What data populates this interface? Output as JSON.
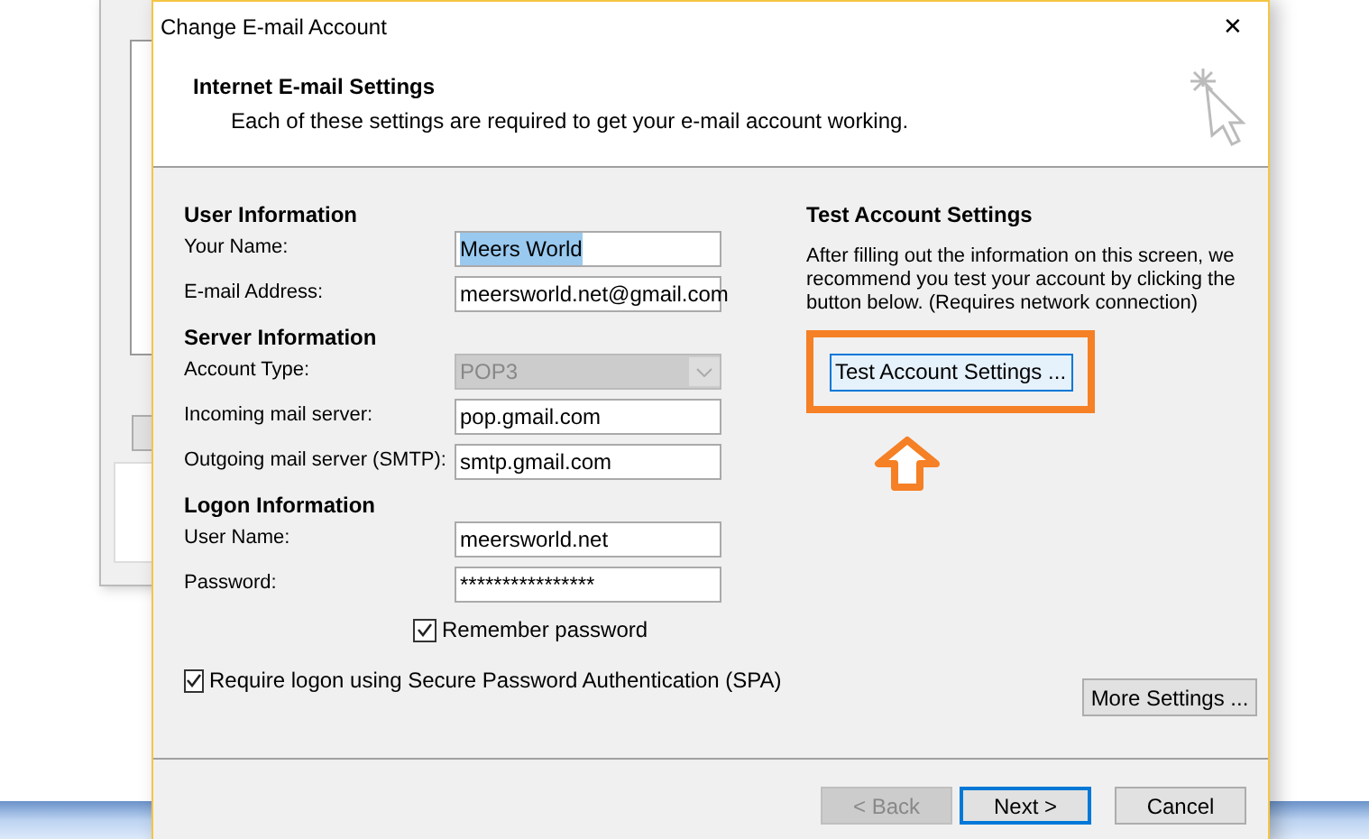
{
  "dialog": {
    "title": "Change E-mail Account",
    "close": "✕",
    "header": {
      "title": "Internet E-mail Settings",
      "subtitle": "Each of these settings are required to get your e-mail account working."
    },
    "sections": [
      {
        "title": "User Information",
        "fields": [
          {
            "label": "Your Name:",
            "value": "Meers World",
            "kind": "text",
            "highlighted": true,
            "disabled": false
          },
          {
            "label": "E-mail Address:",
            "value": "meersworld.net@gmail.com",
            "kind": "text",
            "highlighted": false,
            "disabled": false
          }
        ]
      },
      {
        "title": "Server Information",
        "fields": [
          {
            "label": "Account Type:",
            "value": "POP3",
            "kind": "select",
            "highlighted": false,
            "disabled": true
          },
          {
            "label": "Incoming mail server:",
            "value": "pop.gmail.com",
            "kind": "text",
            "highlighted": false,
            "disabled": false
          },
          {
            "label": "Outgoing mail server (SMTP):",
            "value": "smtp.gmail.com",
            "kind": "text",
            "highlighted": false,
            "disabled": false
          }
        ]
      },
      {
        "title": "Logon Information",
        "fields": [
          {
            "label": "User Name:",
            "value": "meersworld.net",
            "kind": "text",
            "highlighted": false,
            "disabled": false
          },
          {
            "label": "Password:",
            "value": "****************",
            "kind": "text",
            "highlighted": false,
            "disabled": false
          }
        ]
      }
    ],
    "remember_password": {
      "label": "Remember password",
      "checked": true
    },
    "require_spa": {
      "label": "Require logon using Secure Password Authentication (SPA)",
      "checked": true
    },
    "test": {
      "title": "Test Account Settings",
      "text": "After filling out the information on this screen, we recommend you test your account by clicking the button below. (Requires network connection)",
      "button": "Test Account Settings ...",
      "callout": true
    },
    "more_settings": "More Settings ...",
    "buttons": [
      {
        "label": "< Back",
        "disabled": true,
        "default": false
      },
      {
        "label": "Next >",
        "disabled": false,
        "default": true
      },
      {
        "label": "Cancel",
        "disabled": false,
        "default": false
      }
    ]
  }
}
